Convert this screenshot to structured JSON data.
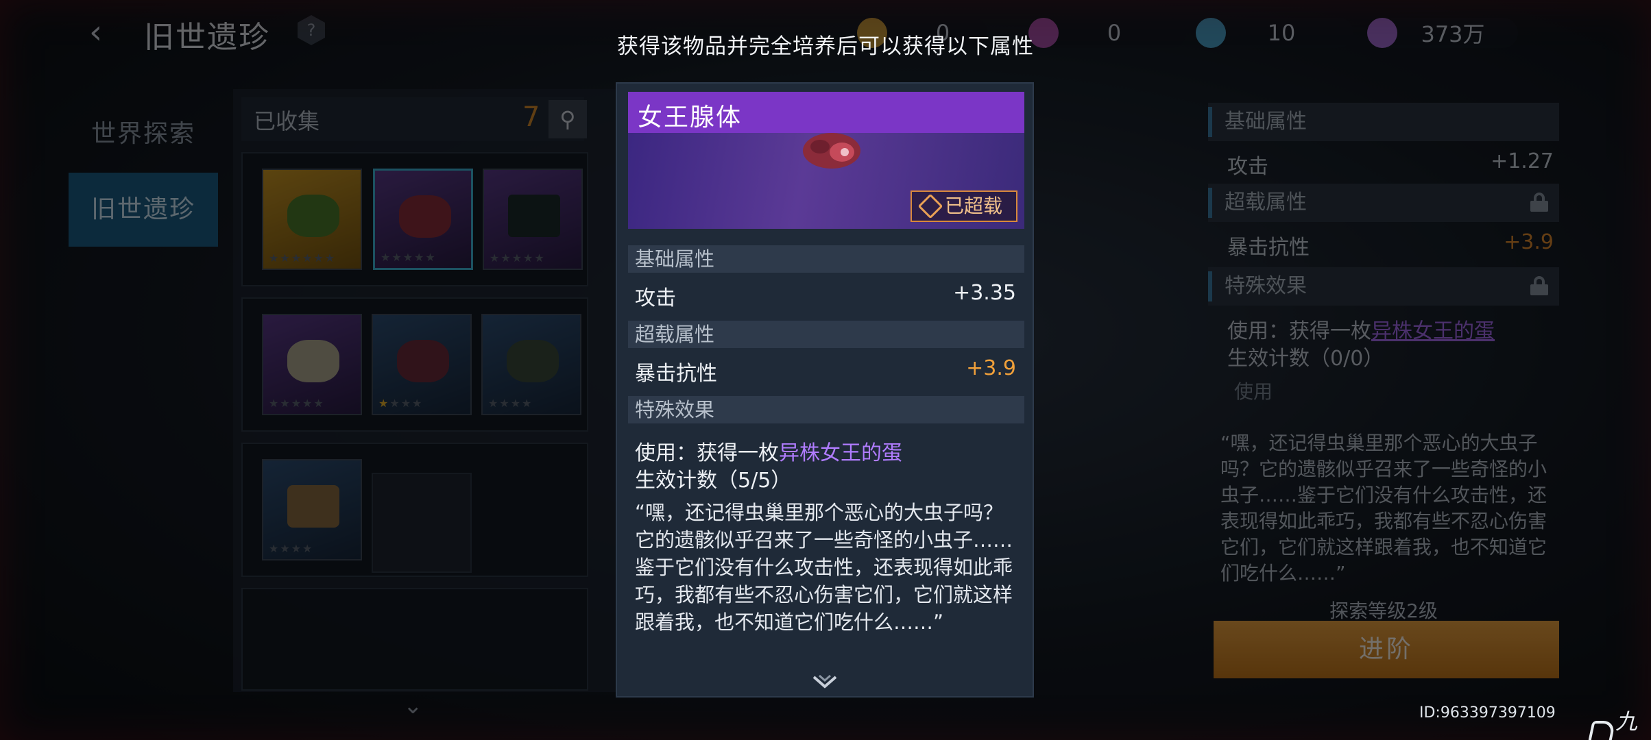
{
  "header": {
    "title": "旧世遗珍",
    "help_glyph": "?",
    "currencies": [
      {
        "icon": "currency-icon",
        "value": "0",
        "color": "#c79a3a"
      },
      {
        "icon": "trophy-icon",
        "value": "0",
        "color": "#a84fa8"
      },
      {
        "icon": "trophy-blue-icon",
        "value": "10",
        "color": "#4aa0c8"
      },
      {
        "icon": "crystal-icon",
        "value": "373万",
        "color": "#a06ad0"
      }
    ]
  },
  "nav": {
    "items": [
      {
        "label": "世界探索",
        "active": false
      },
      {
        "label": "旧世遗珍",
        "active": true
      }
    ]
  },
  "collection": {
    "label": "已收集",
    "count": "7",
    "items": [
      {
        "rarity": "gold",
        "stars_lit": 0,
        "stars_total": 6
      },
      {
        "rarity": "purple",
        "stars_lit": 0,
        "stars_total": 5,
        "selected": true
      },
      {
        "rarity": "purple",
        "stars_lit": 0,
        "stars_total": 5
      },
      {
        "rarity": "purple",
        "stars_lit": 0,
        "stars_total": 5
      },
      {
        "rarity": "blue",
        "stars_lit": 1,
        "stars_total": 4
      },
      {
        "rarity": "blue",
        "stars_lit": 0,
        "stars_total": 4
      },
      {
        "rarity": "blue",
        "stars_lit": 0,
        "stars_total": 4
      }
    ]
  },
  "right_panel": {
    "basic_title": "基础属性",
    "attack_label": "攻击",
    "attack_value": "+1.27",
    "overload_title": "超载属性",
    "crit_resist_label": "暴击抗性",
    "crit_resist_value": "+3.9",
    "special_title": "特殊效果",
    "use_prefix": "使用：获得一枚",
    "use_link": "异株女王的蛋",
    "count_text": "生效计数（0/0）",
    "use_button": "使用",
    "description": "“嘿，还记得虫巢里那个恶心的大虫子吗？它的遗骸似乎召来了一些奇怪的小虫子……鉴于它们没有什么攻击性，还表现得如此乖巧，我都有些不忍心伤害它们，它们就这样跟着我，也不知道它们吃什么……”",
    "level_text": "探索等级2级",
    "advance_button": "进阶"
  },
  "user_id": "ID:963397397109",
  "watermark": "九游",
  "modal": {
    "prompt": "获得该物品并完全培养后可以获得以下属性",
    "item_name": "女王腺体",
    "badge": "已超载",
    "basic_title": "基础属性",
    "attack_label": "攻击",
    "attack_value": "+3.35",
    "overload_title": "超载属性",
    "crit_resist_label": "暴击抗性",
    "crit_resist_value": "+3.9",
    "special_title": "特殊效果",
    "use_prefix": "使用：获得一枚",
    "use_link": "异株女王的蛋",
    "count_text": "生效计数（5/5）",
    "description": "“嘿，还记得虫巢里那个恶心的大虫子吗？它的遗骸似乎召来了一些奇怪的小虫子……鉴于它们没有什么攻击性，还表现得如此乖巧，我都有些不忍心伤害它们，它们就这样跟着我，也不知道它们吃什么……”"
  }
}
